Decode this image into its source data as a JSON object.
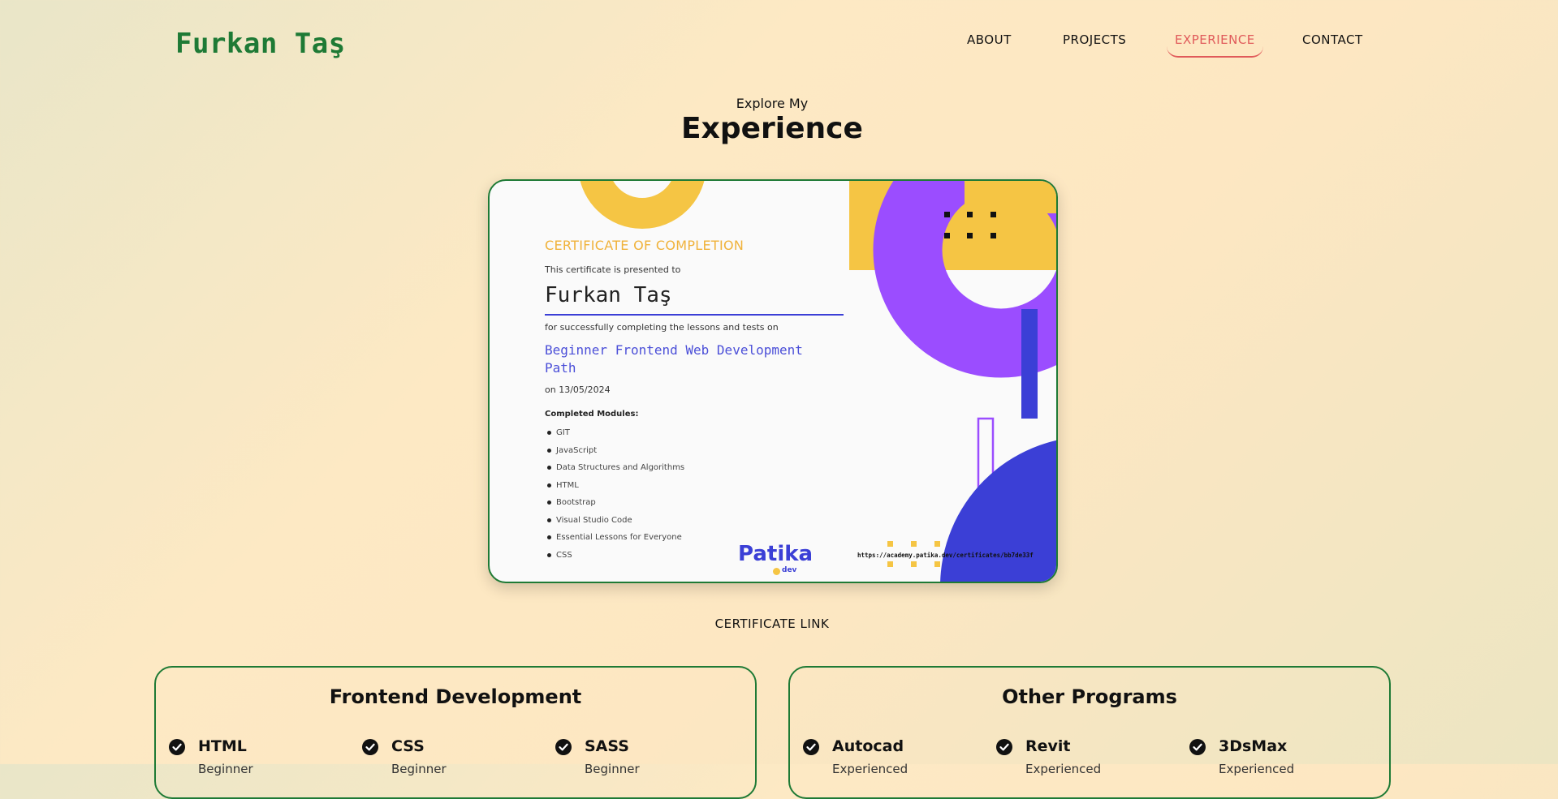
{
  "brand": "Furkan Taş",
  "nav": [
    {
      "label": "ABOUT",
      "active": false
    },
    {
      "label": "PROJECTS",
      "active": false
    },
    {
      "label": "EXPERIENCE",
      "active": true
    },
    {
      "label": "CONTACT",
      "active": false
    }
  ],
  "section": {
    "subtitle": "Explore My",
    "title": "Experience"
  },
  "certificate": {
    "heading": "CERTIFICATE OF COMPLETION",
    "presented": "This certificate is presented to",
    "name": "Furkan Taş",
    "for_text": "for successfully completing the lessons and tests on",
    "course": "Beginner Frontend Web Development Path",
    "date": "on 13/05/2024",
    "modules_label": "Completed Modules:",
    "modules": [
      "GIT",
      "JavaScript",
      "Data Structures and Algorithms",
      "HTML",
      "Bootstrap",
      "Visual Studio Code",
      "Essential Lessons for Everyone",
      "CSS"
    ],
    "brand": "Patika",
    "brand_sub": "dev",
    "url": "https://academy.patika.dev/certificates/bb7de33f"
  },
  "certificate_link": "CERTIFICATE LINK",
  "panels": [
    {
      "title": "Frontend Development",
      "skills": [
        {
          "name": "HTML",
          "level": "Beginner"
        },
        {
          "name": "CSS",
          "level": "Beginner"
        },
        {
          "name": "SASS",
          "level": "Beginner"
        }
      ]
    },
    {
      "title": "Other Programs",
      "skills": [
        {
          "name": "Autocad",
          "level": "Experienced"
        },
        {
          "name": "Revit",
          "level": "Experienced"
        },
        {
          "name": "3DsMax",
          "level": "Experienced"
        }
      ]
    }
  ],
  "colors": {
    "accent": "#1e7a35",
    "active": "#e05a5a",
    "cert_blue": "#3b3fd6",
    "cert_yellow": "#f5c544",
    "cert_purple": "#9b4dff"
  }
}
